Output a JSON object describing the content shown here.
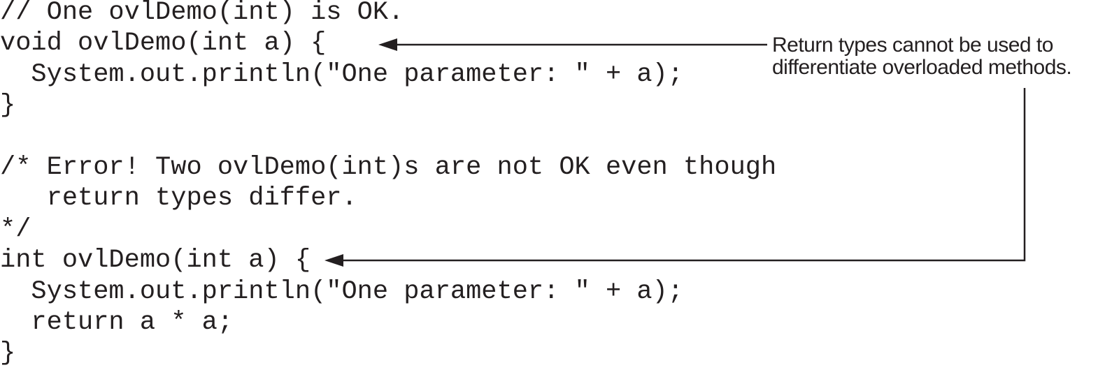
{
  "code_lines": [
    "// One ovlDemo(int) is OK.",
    "void ovlDemo(int a) {",
    "  System.out.println(\"One parameter: \" + a);",
    "}",
    "",
    "/* Error! Two ovlDemo(int)s are not OK even though",
    "   return types differ.",
    "*/",
    "int ovlDemo(int a) {",
    "  System.out.println(\"One parameter: \" + a);",
    "  return a * a;",
    "}"
  ],
  "callout": {
    "line1": "Return types cannot be used to",
    "line2": "differentiate overloaded methods."
  },
  "colors": {
    "ink": "#231f20",
    "background": "#ffffff"
  }
}
